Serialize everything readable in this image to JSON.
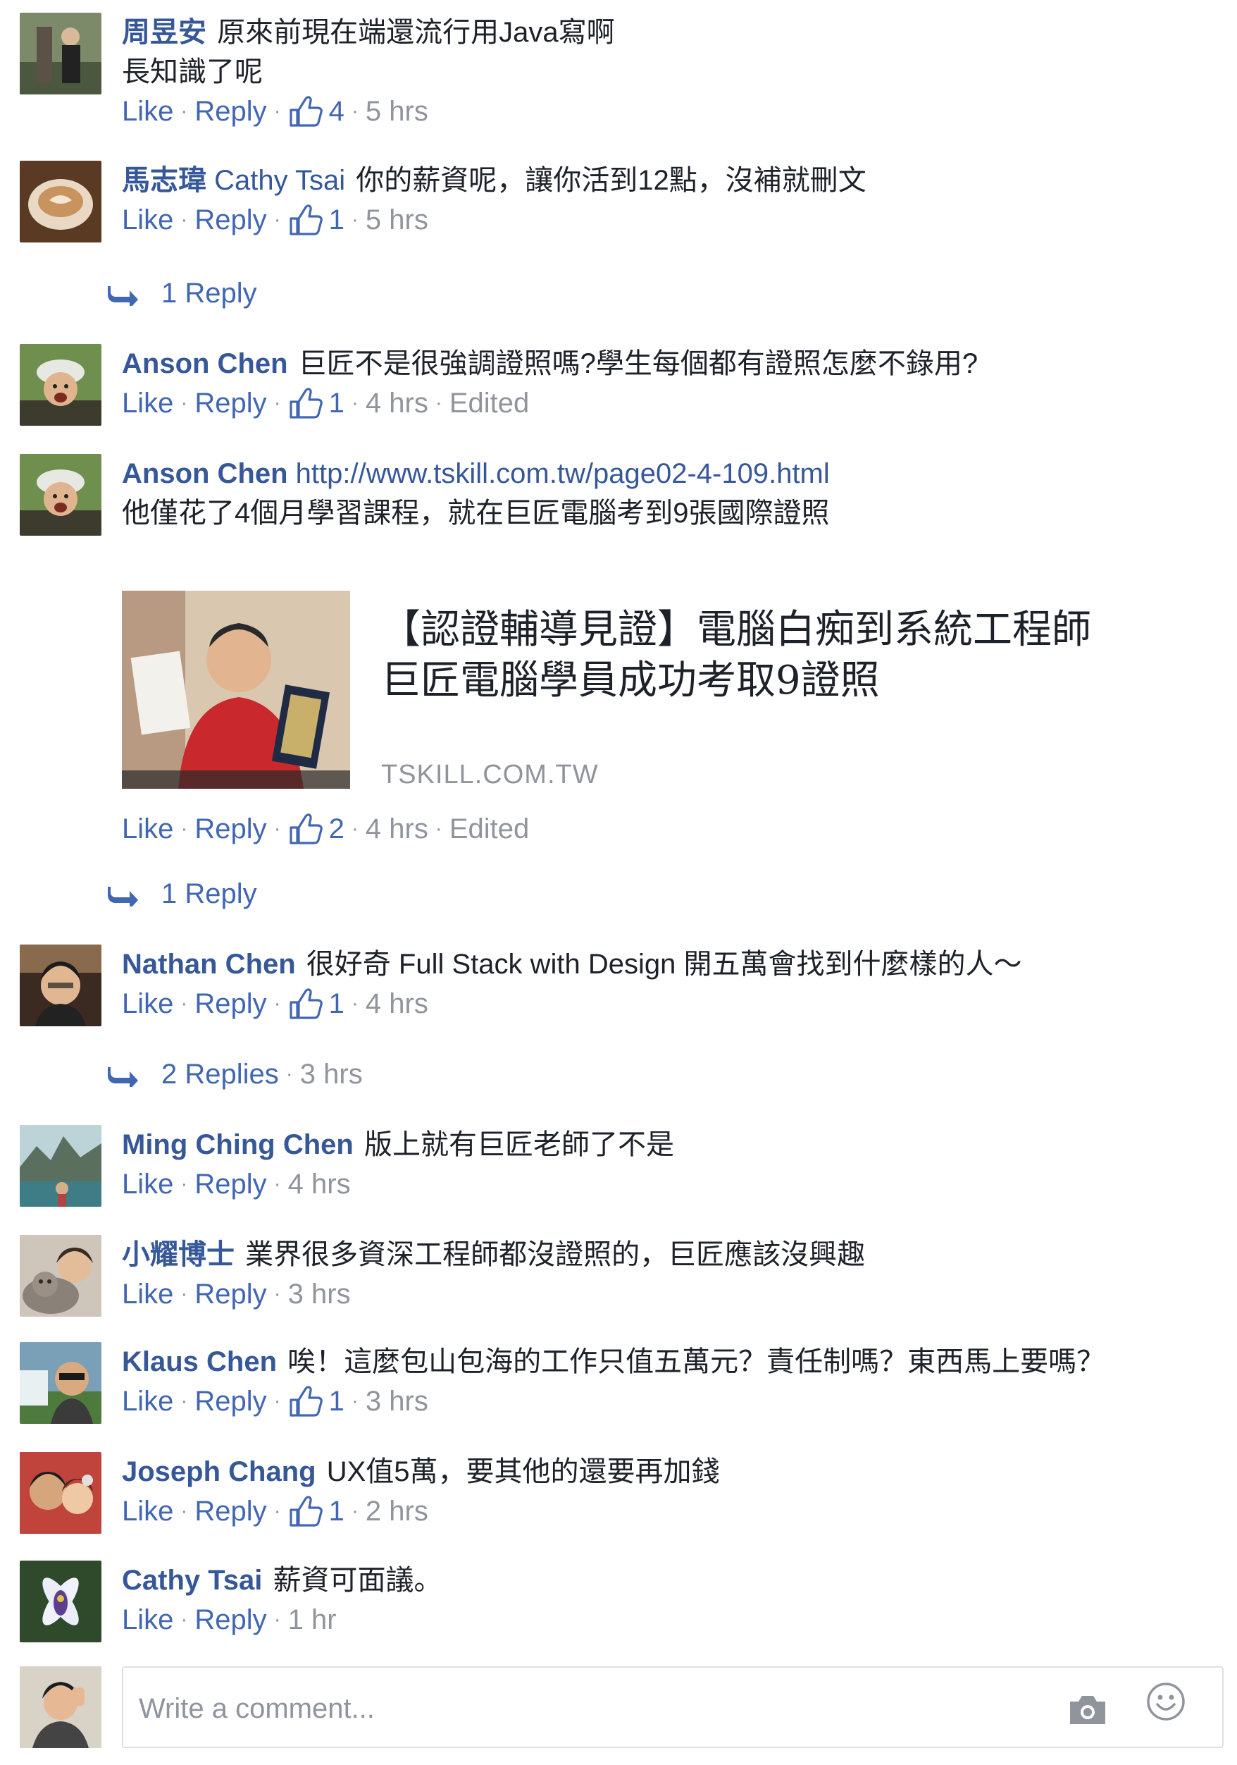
{
  "actions": {
    "like": "Like",
    "reply": "Reply",
    "sep": "·"
  },
  "comments": [
    {
      "author": "周昱安",
      "lines": [
        "原來前現在端還流行用Java寫啊",
        "長知識了呢"
      ],
      "likes": "4",
      "time": "5 hrs"
    },
    {
      "author": "馬志瑋",
      "mention": "Cathy Tsai",
      "text": "你的薪資呢，讓你活到12點，沒補就刪文",
      "likes": "1",
      "time": "5 hrs",
      "replies": "1 Reply"
    },
    {
      "author": "Anson Chen",
      "text": "巨匠不是很強調證照嗎?學生每個都有證照怎麼不錄用?",
      "likes": "1",
      "time": "4 hrs",
      "edited": "Edited"
    },
    {
      "author": "Anson Chen",
      "link": "http://www.tskill.com.tw/page02-4-109.html",
      "text": "他僅花了4個月學習課程，就在巨匠電腦考到9張國際證照",
      "likes": "2",
      "time": "4 hrs",
      "edited": "Edited",
      "replies": "1 Reply",
      "preview": {
        "title_line1": "【認證輔導見證】電腦白痴到系統工程師",
        "title_line2": "巨匠電腦學員成功考取9證照",
        "domain": "TSKILL.COM.TW"
      }
    },
    {
      "author": "Nathan Chen",
      "text": "很好奇 Full Stack with Design 開五萬會找到什麼樣的人～",
      "likes": "1",
      "time": "4 hrs",
      "replies": "2 Replies",
      "replies_time": "3 hrs"
    },
    {
      "author": "Ming Ching Chen",
      "text": "版上就有巨匠老師了不是",
      "time": "4 hrs"
    },
    {
      "author": "小耀博士",
      "text": "業界很多資深工程師都沒證照的，巨匠應該沒興趣",
      "time": "3 hrs"
    },
    {
      "author": "Klaus Chen",
      "text": "唉！這麼包山包海的工作只值五萬元？責任制嗎？東西馬上要嗎？",
      "likes": "1",
      "time": "3 hrs"
    },
    {
      "author": "Joseph Chang",
      "text": "UX值5萬，要其他的還要再加錢",
      "likes": "1",
      "time": "2 hrs"
    },
    {
      "author": "Cathy Tsai",
      "text": "薪資可面議。",
      "time": "1 hr"
    }
  ],
  "composer": {
    "placeholder": "Write a comment..."
  },
  "colors": {
    "link": "#365899",
    "action": "#4267b2",
    "meta": "#90949c",
    "text": "#1d2129"
  },
  "icons": [
    "thumbs-up-icon",
    "reply-arrow-icon",
    "camera-icon",
    "emoji-icon"
  ]
}
